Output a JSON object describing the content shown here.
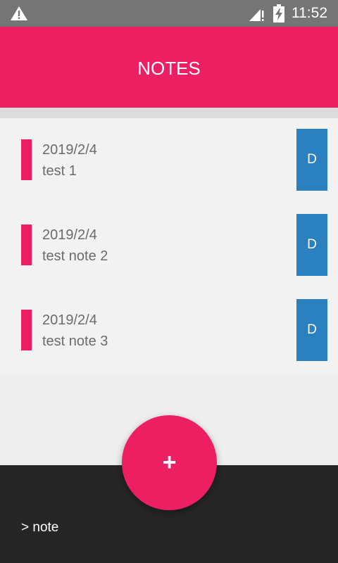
{
  "status_bar": {
    "time": "11:52",
    "icons": [
      "warning-icon",
      "signal-icon",
      "battery-charging-icon"
    ]
  },
  "app_bar": {
    "title": "NOTES"
  },
  "notes": [
    {
      "date": "2019/2/4",
      "title": "test 1",
      "delete_label": "D"
    },
    {
      "date": "2019/2/4",
      "title": "test note 2",
      "delete_label": "D"
    },
    {
      "date": "2019/2/4",
      "title": "test note 3",
      "delete_label": "D"
    }
  ],
  "fab": {
    "icon": "plus-icon",
    "label": "+"
  },
  "bottom_bar": {
    "label": "> note"
  },
  "colors": {
    "accent": "#ec1f63",
    "delete_button": "#2b80c0",
    "status_bar": "#757575",
    "bottom_bar": "#262626",
    "list_background": "#f2f2f2",
    "text_muted": "#6b6b6b"
  }
}
